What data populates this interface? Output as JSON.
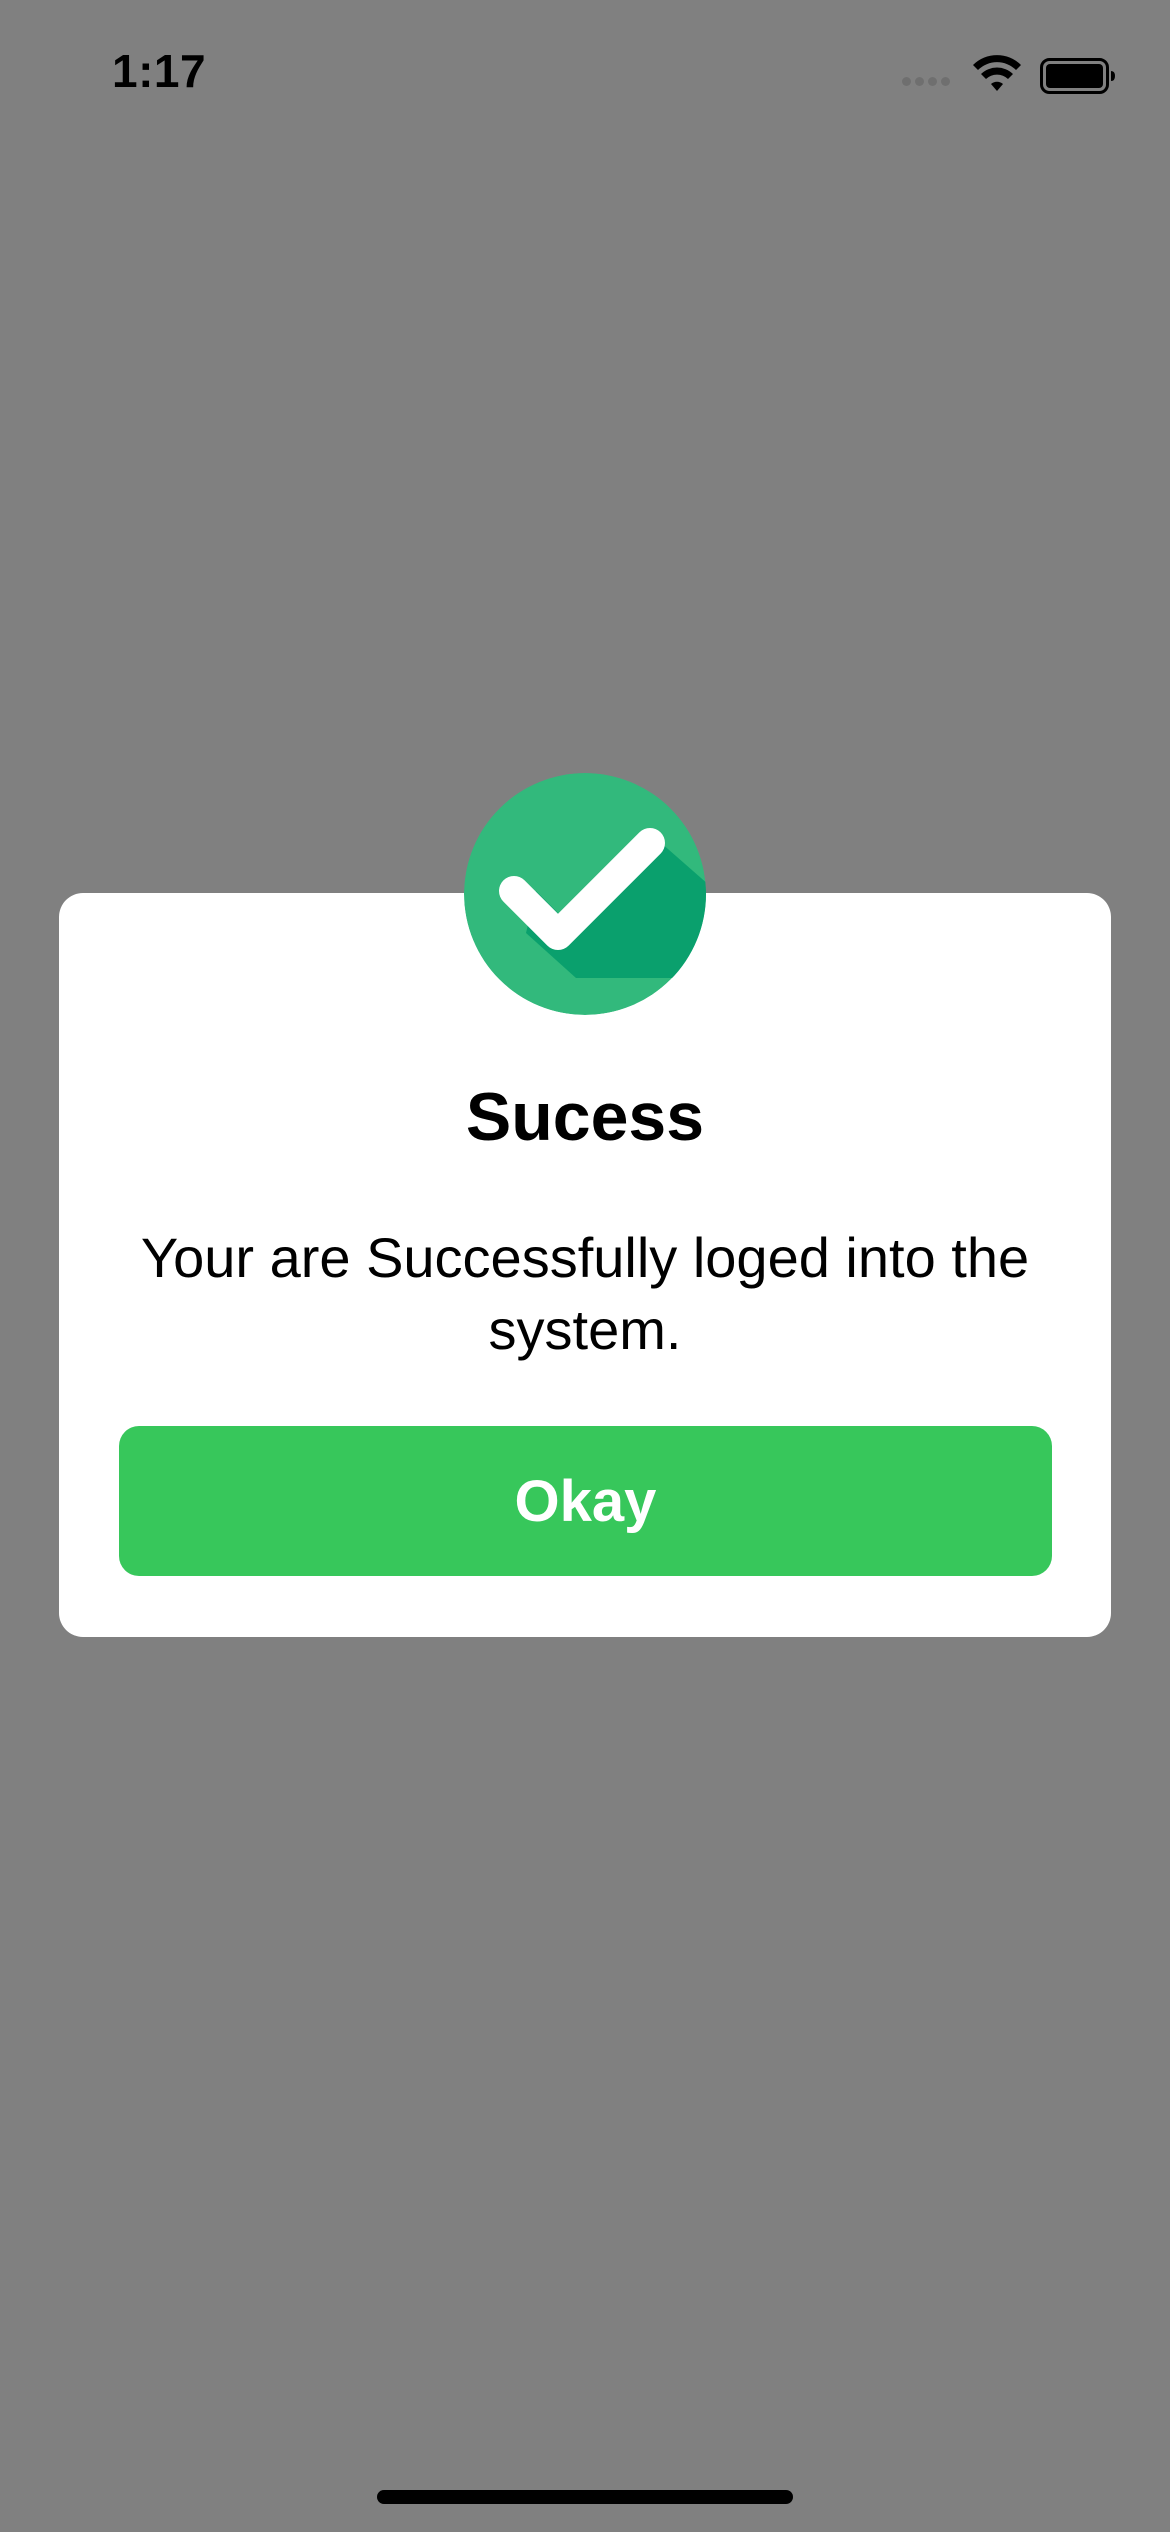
{
  "status_bar": {
    "time": "1:17",
    "signal_icon": "cellular-signal-dots-icon",
    "wifi_icon": "wifi-icon",
    "battery_icon": "battery-full-icon"
  },
  "alert": {
    "icon": "checkmark-circle-icon",
    "title": "Sucess",
    "message": "Your are Successfully loged into the system.",
    "button_label": "Okay"
  },
  "colors": {
    "overlay": "#808080",
    "success_circle": "#32b97c",
    "success_circle_shadow": "#0aa06d",
    "button": "#37c75b",
    "button_text": "#ffffff"
  }
}
